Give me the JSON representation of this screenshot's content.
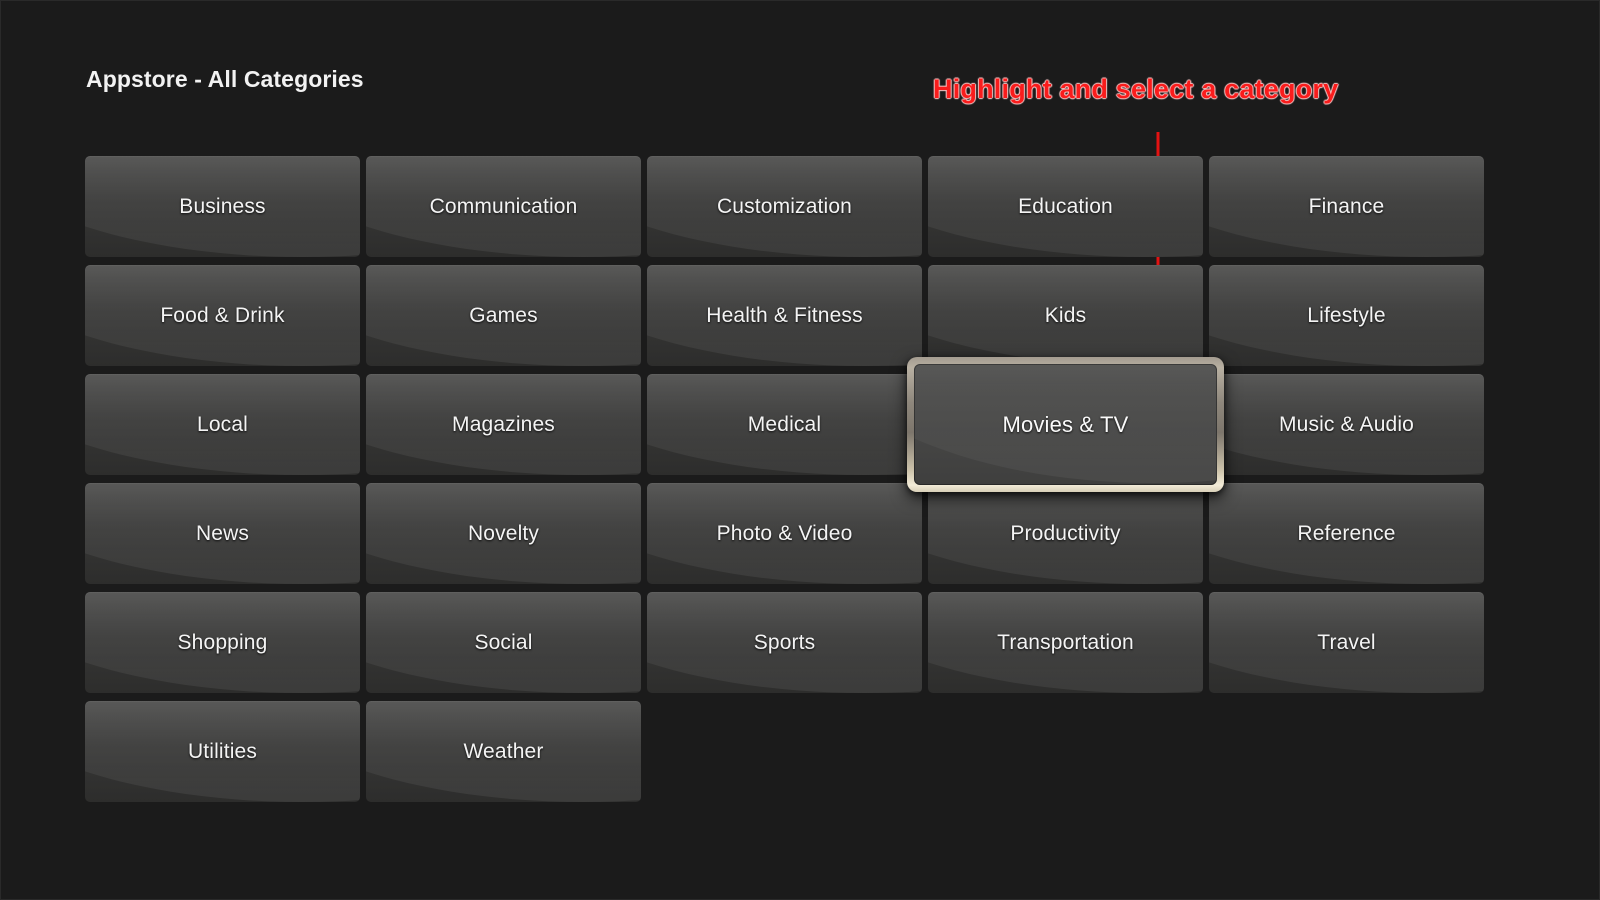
{
  "header": {
    "title": "Appstore - All Categories"
  },
  "annotation": {
    "text": "Highlight and select a category",
    "color": "#f91c1c",
    "arrow_icon": "down-arrow-icon"
  },
  "colors": {
    "background": "#1b1b1b",
    "tile_top": "#555554",
    "tile_bottom": "#2d2d2c",
    "selected_border": "#b5ab9c",
    "selected_border_highlight": "#f3ecd8",
    "label_text": "#f4f4f4",
    "annotation_red": "#f91c1c"
  },
  "grid": {
    "columns": 5,
    "rows": 6,
    "selected_index": 13,
    "tiles": [
      {
        "label": "Business",
        "row": 0,
        "col": 0,
        "selected": false
      },
      {
        "label": "Communication",
        "row": 0,
        "col": 1,
        "selected": false
      },
      {
        "label": "Customization",
        "row": 0,
        "col": 2,
        "selected": false
      },
      {
        "label": "Education",
        "row": 0,
        "col": 3,
        "selected": false
      },
      {
        "label": "Finance",
        "row": 0,
        "col": 4,
        "selected": false
      },
      {
        "label": "Food & Drink",
        "row": 1,
        "col": 0,
        "selected": false
      },
      {
        "label": "Games",
        "row": 1,
        "col": 1,
        "selected": false
      },
      {
        "label": "Health & Fitness",
        "row": 1,
        "col": 2,
        "selected": false
      },
      {
        "label": "Kids",
        "row": 1,
        "col": 3,
        "selected": false
      },
      {
        "label": "Lifestyle",
        "row": 1,
        "col": 4,
        "selected": false
      },
      {
        "label": "Local",
        "row": 2,
        "col": 0,
        "selected": false
      },
      {
        "label": "Magazines",
        "row": 2,
        "col": 1,
        "selected": false
      },
      {
        "label": "Medical",
        "row": 2,
        "col": 2,
        "selected": false
      },
      {
        "label": "Movies & TV",
        "row": 2,
        "col": 3,
        "selected": true
      },
      {
        "label": "Music & Audio",
        "row": 2,
        "col": 4,
        "selected": false
      },
      {
        "label": "News",
        "row": 3,
        "col": 0,
        "selected": false
      },
      {
        "label": "Novelty",
        "row": 3,
        "col": 1,
        "selected": false
      },
      {
        "label": "Photo & Video",
        "row": 3,
        "col": 2,
        "selected": false
      },
      {
        "label": "Productivity",
        "row": 3,
        "col": 3,
        "selected": false
      },
      {
        "label": "Reference",
        "row": 3,
        "col": 4,
        "selected": false
      },
      {
        "label": "Shopping",
        "row": 4,
        "col": 0,
        "selected": false
      },
      {
        "label": "Social",
        "row": 4,
        "col": 1,
        "selected": false
      },
      {
        "label": "Sports",
        "row": 4,
        "col": 2,
        "selected": false
      },
      {
        "label": "Transportation",
        "row": 4,
        "col": 3,
        "selected": false
      },
      {
        "label": "Travel",
        "row": 4,
        "col": 4,
        "selected": false
      },
      {
        "label": "Utilities",
        "row": 5,
        "col": 0,
        "selected": false
      },
      {
        "label": "Weather",
        "row": 5,
        "col": 1,
        "selected": false
      }
    ]
  }
}
